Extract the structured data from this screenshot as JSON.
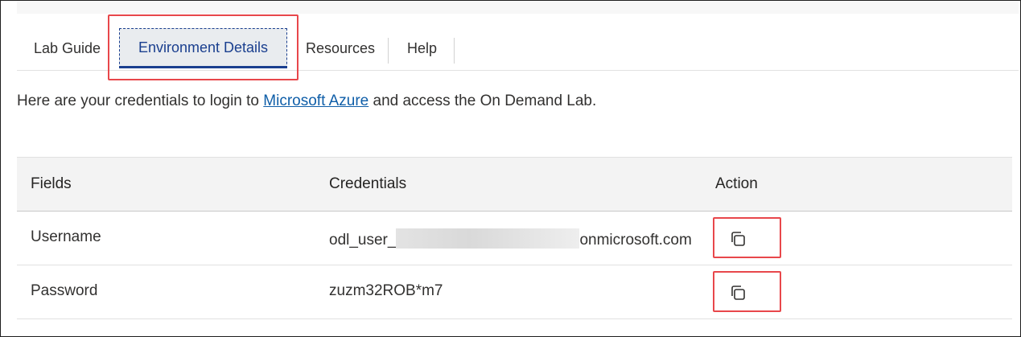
{
  "tabs": [
    {
      "label": "Lab Guide"
    },
    {
      "label": "Environment Details",
      "active": true
    },
    {
      "label": "Resources"
    },
    {
      "label": "Help"
    }
  ],
  "intro": {
    "before": "Here are your credentials to login to ",
    "link": "Microsoft Azure",
    "after": " and access the On Demand Lab."
  },
  "table": {
    "headers": [
      "Fields",
      "Credentials",
      "Action"
    ],
    "rows": [
      {
        "field": "Username",
        "credential_prefix": "odl_user_",
        "credential_suffix": "onmicrosoft.com",
        "action_icon": "copy-icon"
      },
      {
        "field": "Password",
        "credential": "zuzm32ROB*m7",
        "action_icon": "copy-icon"
      }
    ]
  },
  "colors": {
    "accent": "#1a3f8f",
    "highlight": "#e8474b",
    "link": "#0f5ea8"
  }
}
